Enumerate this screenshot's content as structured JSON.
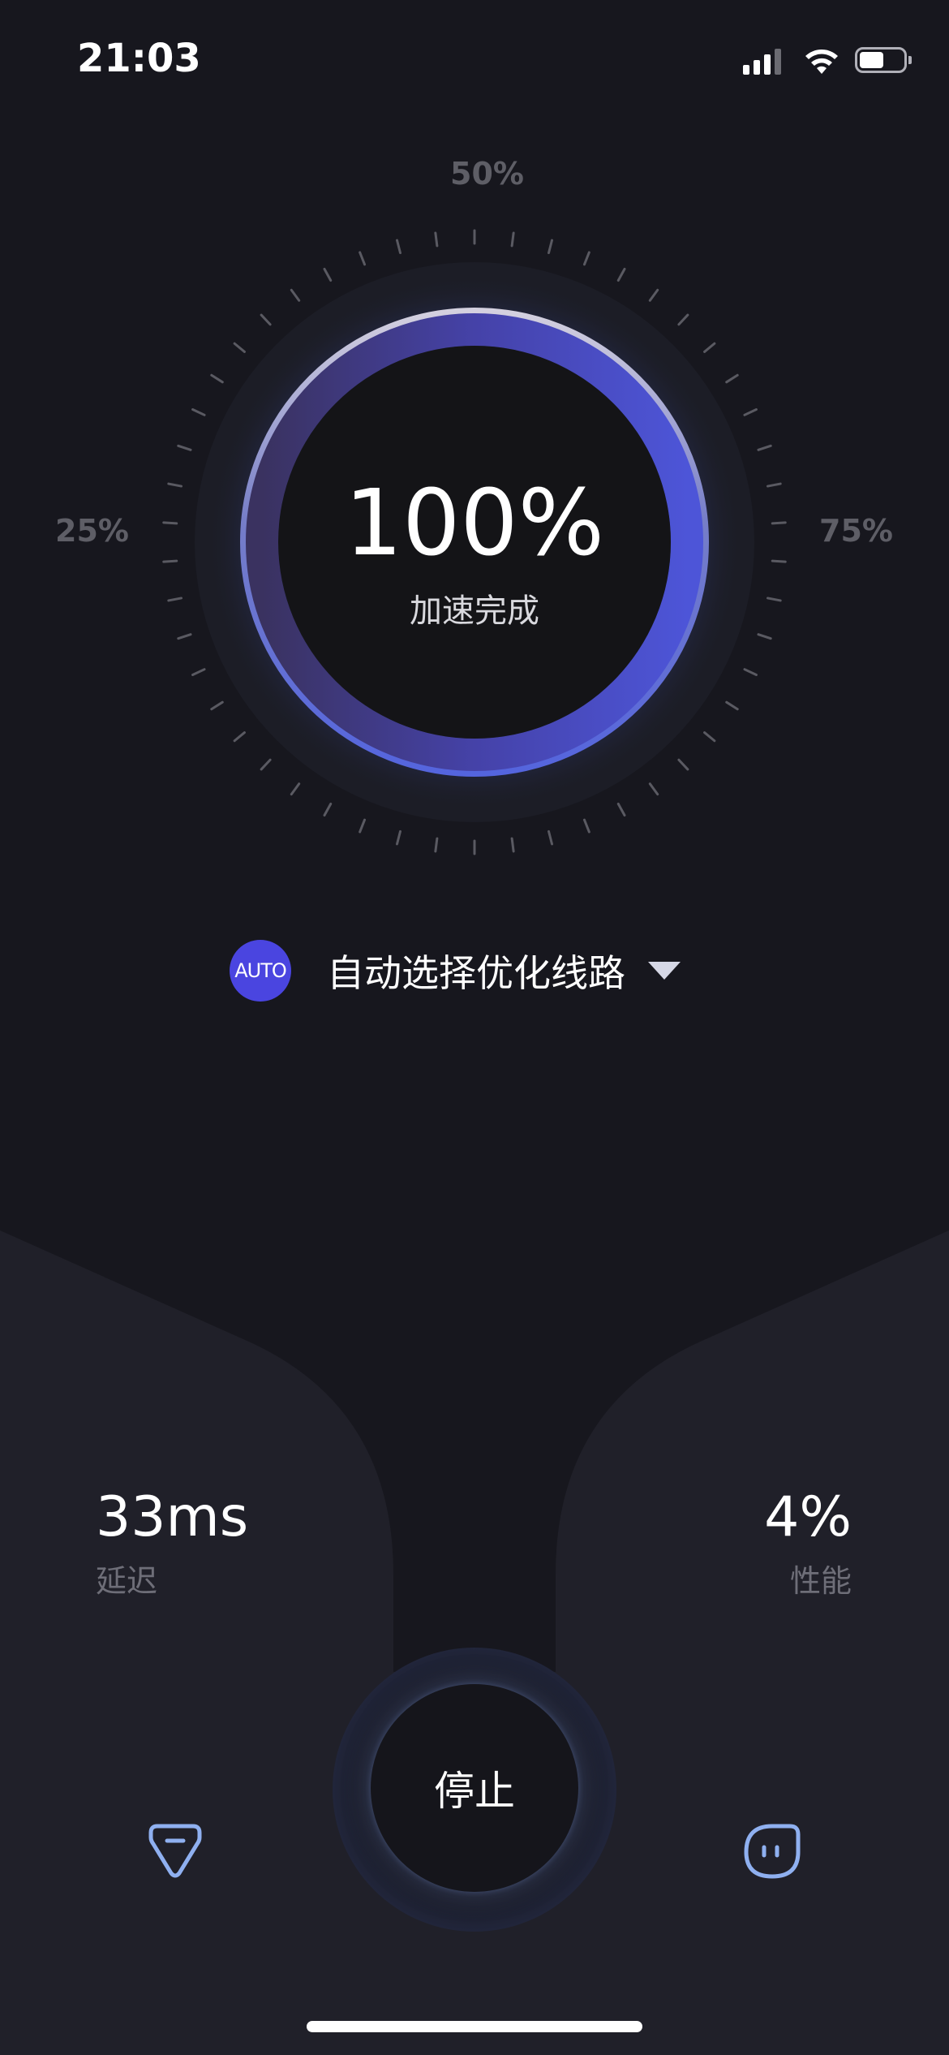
{
  "status_bar": {
    "time": "21:03",
    "signal_icon": "cellular-signal-icon",
    "wifi_icon": "wifi-icon",
    "battery_icon": "battery-icon",
    "battery_level": 0.55
  },
  "dial": {
    "label_25": "25%",
    "label_50": "50%",
    "label_75": "75%",
    "percent": "100%",
    "status": "加速完成",
    "progress": 1.0
  },
  "route": {
    "badge": "AUTO",
    "label": "自动选择优化线路",
    "caret_icon": "caret-down-icon"
  },
  "stats": {
    "latency_value": "33ms",
    "latency_label": "延迟",
    "performance_value": "4%",
    "performance_label": "性能"
  },
  "stop_button": {
    "label": "停止"
  },
  "nav": {
    "left_icon": "gem-icon",
    "right_icon": "face-icon"
  },
  "colors": {
    "background": "#17171e",
    "panel": "#202029",
    "accent": "#4a45e0",
    "ring": "#4d55d8",
    "icon": "#8fb0f0"
  }
}
